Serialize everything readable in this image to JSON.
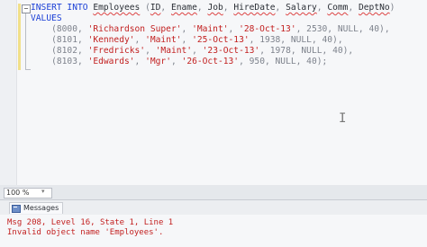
{
  "editor": {
    "lines": [
      [
        {
          "t": "INSERT INTO ",
          "c": "kw"
        },
        {
          "t": "Employees",
          "c": "ident"
        },
        {
          "t": " (",
          "c": "gray"
        },
        {
          "t": "ID",
          "c": "ident"
        },
        {
          "t": ", ",
          "c": "gray"
        },
        {
          "t": "Ename",
          "c": "ident"
        },
        {
          "t": ", ",
          "c": "gray"
        },
        {
          "t": "Job",
          "c": "ident"
        },
        {
          "t": ", ",
          "c": "gray"
        },
        {
          "t": "HireDate",
          "c": "ident"
        },
        {
          "t": ", ",
          "c": "gray"
        },
        {
          "t": "Salary",
          "c": "ident"
        },
        {
          "t": ", ",
          "c": "gray"
        },
        {
          "t": "Comm",
          "c": "ident"
        },
        {
          "t": ", ",
          "c": "gray"
        },
        {
          "t": "DeptNo",
          "c": "ident"
        },
        {
          "t": ")",
          "c": "gray"
        }
      ],
      [
        {
          "t": "VALUES",
          "c": "kw"
        }
      ],
      [
        {
          "t": "    (8000, ",
          "c": "gray"
        },
        {
          "t": "'Richardson Super'",
          "c": "str"
        },
        {
          "t": ", ",
          "c": "gray"
        },
        {
          "t": "'Maint'",
          "c": "str"
        },
        {
          "t": ", ",
          "c": "gray"
        },
        {
          "t": "'28-Oct-13'",
          "c": "str"
        },
        {
          "t": ", 2530, NULL, 40),",
          "c": "gray"
        }
      ],
      [
        {
          "t": "    (8101, ",
          "c": "gray"
        },
        {
          "t": "'Kennedy'",
          "c": "str"
        },
        {
          "t": ", ",
          "c": "gray"
        },
        {
          "t": "'Maint'",
          "c": "str"
        },
        {
          "t": ", ",
          "c": "gray"
        },
        {
          "t": "'25-Oct-13'",
          "c": "str"
        },
        {
          "t": ", 1938, NULL, 40),",
          "c": "gray"
        }
      ],
      [
        {
          "t": "    (8102, ",
          "c": "gray"
        },
        {
          "t": "'Fredricks'",
          "c": "str"
        },
        {
          "t": ", ",
          "c": "gray"
        },
        {
          "t": "'Maint'",
          "c": "str"
        },
        {
          "t": ", ",
          "c": "gray"
        },
        {
          "t": "'23-Oct-13'",
          "c": "str"
        },
        {
          "t": ", 1978, NULL, 40),",
          "c": "gray"
        }
      ],
      [
        {
          "t": "    (8103, ",
          "c": "gray"
        },
        {
          "t": "'Edwards'",
          "c": "str"
        },
        {
          "t": ", ",
          "c": "gray"
        },
        {
          "t": "'Mgr'",
          "c": "str"
        },
        {
          "t": ", ",
          "c": "gray"
        },
        {
          "t": "'26-Oct-13'",
          "c": "str"
        },
        {
          "t": ", 950, NULL, 40);",
          "c": "gray"
        }
      ]
    ],
    "collapse_glyph": "−",
    "cursor_glyph": "I"
  },
  "statusbar": {
    "zoom": "100 %",
    "zoom_arrow": "▾"
  },
  "results_tabs": [
    {
      "label": "Messages",
      "icon": "messages-icon"
    }
  ],
  "messages": [
    "Msg 208, Level 16, State 1, Line 1",
    "Invalid object name 'Employees'."
  ],
  "colors": {
    "keyword": "#1a3fd6",
    "string": "#c21f1f",
    "error": "#c21f1f",
    "punctuation": "#7d828c"
  }
}
